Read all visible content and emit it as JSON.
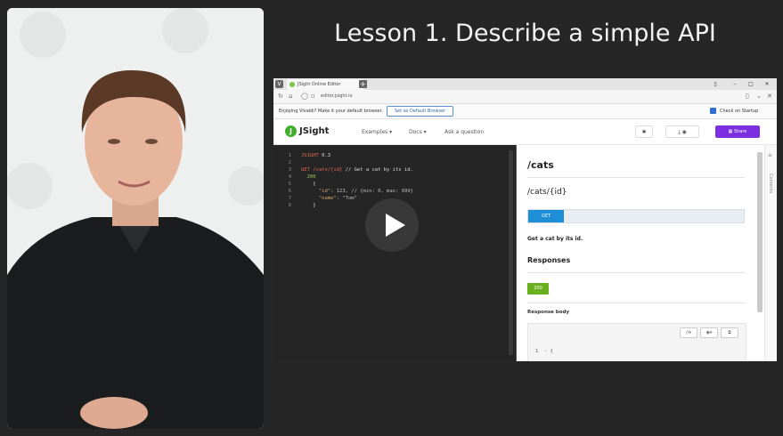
{
  "lesson": {
    "title": "Lesson 1. Describe a simple API"
  },
  "browser": {
    "tab_title": "JSight Online Editor",
    "url": "editor.jsight.io",
    "notification_text": "Enjoying Vivaldi? Make it your default browser.",
    "default_button": "Set as Default Browser",
    "startup_label": "Check on Startup"
  },
  "app": {
    "logo_text": "JSight",
    "menu": [
      "Examples ▾",
      "Docs ▾",
      "Ask a question"
    ],
    "share_label": "Share"
  },
  "editor": {
    "lines": [
      {
        "n": "1",
        "parts": [
          {
            "t": "JSIGHT",
            "c": "kw"
          },
          {
            "t": " 0.3",
            "c": "plain"
          }
        ]
      },
      {
        "n": "2",
        "parts": []
      },
      {
        "n": "3",
        "parts": [
          {
            "t": "GET /cats/{id}",
            "c": "kw"
          },
          {
            "t": " // Get a cat by its id.",
            "c": "plain"
          }
        ]
      },
      {
        "n": "4",
        "parts": [
          {
            "t": "  200",
            "c": "num"
          }
        ]
      },
      {
        "n": "5",
        "parts": [
          {
            "t": "    {",
            "c": "plain"
          }
        ]
      },
      {
        "n": "6",
        "parts": [
          {
            "t": "      \"id\"",
            "c": "str"
          },
          {
            "t": ": 123, // {min: 0, max: 999}",
            "c": "cmt"
          }
        ]
      },
      {
        "n": "7",
        "parts": [
          {
            "t": "      \"name\"",
            "c": "str"
          },
          {
            "t": ": \"Tom\"",
            "c": "cmt"
          }
        ]
      },
      {
        "n": "8",
        "parts": [
          {
            "t": "    }",
            "c": "plain"
          }
        ]
      }
    ]
  },
  "doc": {
    "resource": "/cats",
    "path": "/cats/{id}",
    "method": "GET",
    "description": "Get a cat by its id.",
    "responses_heading": "Responses",
    "status_code": "200",
    "response_body_label": "Response body",
    "response_code_preview": "1  - {",
    "contents_label": "Contents"
  }
}
